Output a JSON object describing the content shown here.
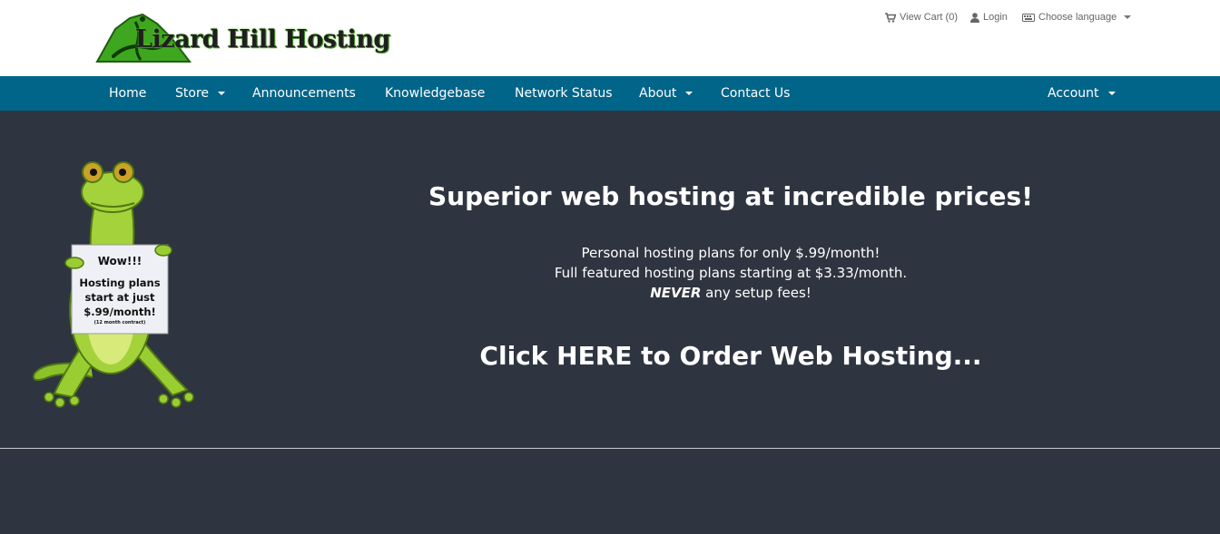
{
  "header": {
    "logo_text": "Lizard Hill Hosting",
    "view_cart_label": "View Cart (0)",
    "login_label": "Login",
    "language_label": "Choose language"
  },
  "nav": {
    "home": "Home",
    "store": "Store",
    "announcements": "Announcements",
    "knowledgebase": "Knowledgebase",
    "network_status": "Network Status",
    "about": "About",
    "contact": "Contact Us",
    "account": "Account"
  },
  "hero": {
    "sign": {
      "line1": "Wow!!!",
      "line2": "Hosting plans",
      "line3": "start at just",
      "line4": "$.99/month!",
      "line5": "(12 month contract)"
    },
    "headline": "Superior web hosting at incredible prices!",
    "line1": "Personal hosting plans for only $.99/month!",
    "line2": "Full featured hosting plans starting at $3.33/month.",
    "line3_emphasis": "NEVER",
    "line3_rest": " any setup fees!",
    "cta": "Click HERE to Order Web Hosting..."
  },
  "colors": {
    "navbar": "#006589",
    "hero_background": "#2e3540",
    "header_background": "#ffffff",
    "logo_green": "#3fa61f"
  },
  "icons": {
    "cart": "cart-icon",
    "login": "user-icon",
    "language": "keyboard-icon",
    "logo": "lizard-hill-logo-icon",
    "gecko": "gecko-mascot-icon"
  }
}
